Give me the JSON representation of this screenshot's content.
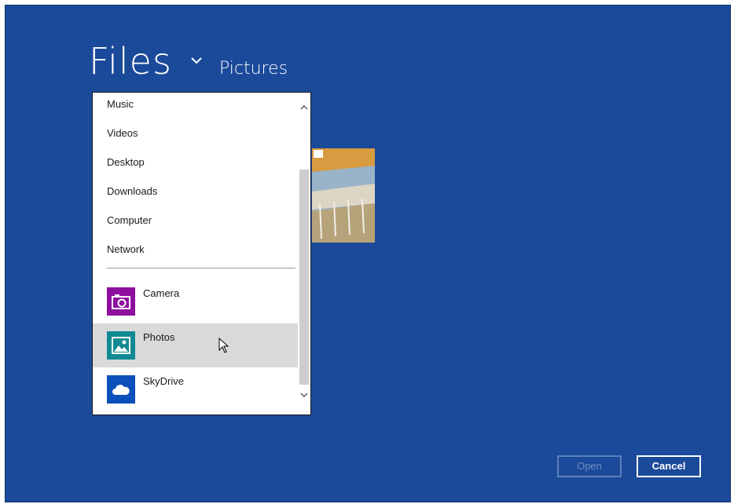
{
  "header": {
    "title": "Files",
    "location": "Pictures"
  },
  "dropdown": {
    "locations": [
      {
        "label": "Music"
      },
      {
        "label": "Videos"
      },
      {
        "label": "Desktop"
      },
      {
        "label": "Downloads"
      },
      {
        "label": "Computer"
      },
      {
        "label": "Network"
      }
    ],
    "apps": [
      {
        "label": "Camera",
        "icon": "camera-icon",
        "color": "#8e0f9e"
      },
      {
        "label": "Photos",
        "icon": "photos-icon",
        "color": "#128a94"
      },
      {
        "label": "SkyDrive",
        "icon": "cloud-icon",
        "color": "#0b4fba"
      }
    ]
  },
  "actions": {
    "open_label": "Open",
    "cancel_label": "Cancel"
  },
  "colors": {
    "background": "#1b4a9a",
    "hover": "#d9d9d9"
  }
}
